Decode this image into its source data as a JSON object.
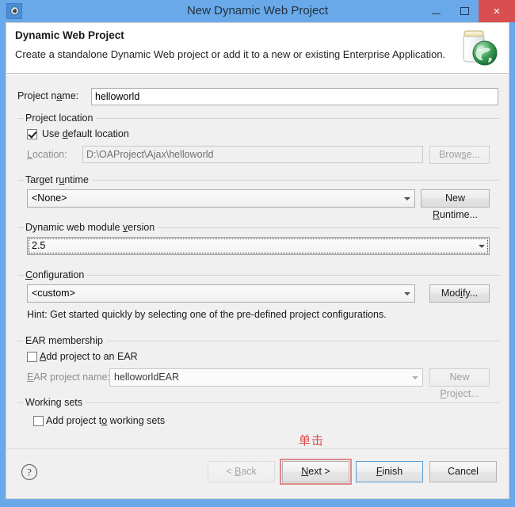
{
  "window": {
    "title": "New Dynamic Web Project",
    "icon": "gear-icon",
    "controls": {
      "minimize": "minimize-icon",
      "maximize": "maximize-icon",
      "close": "×"
    },
    "titlebar_color": "#6aa9e9",
    "close_color": "#d94f4f"
  },
  "header": {
    "title": "Dynamic Web Project",
    "description": "Create a standalone Dynamic Web project or add it to a new or existing Enterprise Application.",
    "icon": "jar-with-globe-icon"
  },
  "form": {
    "project_name": {
      "label": "Project name:",
      "label_pre": "Project n",
      "label_mnemonic": "a",
      "label_post": "me:",
      "value": "helloworld",
      "placeholder": ""
    },
    "project_location": {
      "legend": "Project location",
      "use_default": {
        "label_pre": "Use ",
        "label_mnemonic": "d",
        "label_post": "efault location",
        "checked": true
      },
      "location": {
        "label_mnemonic": "L",
        "label_post": "ocation:",
        "value": "D:\\OAProject\\Ajax\\helloworld",
        "disabled": true
      },
      "browse_button": {
        "label_pre": "Brow",
        "label_mnemonic": "s",
        "label_post": "e...",
        "disabled": true
      }
    },
    "target_runtime": {
      "legend_pre": "Target r",
      "legend_mnemonic": "u",
      "legend_post": "ntime",
      "selected": "<None>",
      "new_button": {
        "label_pre": "New ",
        "label_mnemonic": "R",
        "label_post": "untime..."
      }
    },
    "module_version": {
      "legend_pre": "Dynamic web module ",
      "legend_mnemonic": "v",
      "legend_post": "ersion",
      "selected": "2.5",
      "focused": true
    },
    "configuration": {
      "legend_mnemonic": "C",
      "legend_post": "onfiguration",
      "selected": "<custom>",
      "modify_button": {
        "label_pre": "Mod",
        "label_mnemonic": "i",
        "label_post": "fy..."
      },
      "hint": "Hint: Get started quickly by selecting one of the pre-defined project configurations."
    },
    "ear_membership": {
      "legend": "EAR membership",
      "add_to_ear": {
        "label_mnemonic": "A",
        "label_post": "dd project to an EAR",
        "checked": false
      },
      "ear_project_name": {
        "label_mnemonic": "E",
        "label_post": "AR project name:",
        "value": "helloworldEAR",
        "disabled": true
      },
      "new_project_button": {
        "label_pre": "New ",
        "label_mnemonic": "P",
        "label_post": "roject...",
        "disabled": true
      }
    },
    "working_sets": {
      "legend": "Working sets",
      "add_to_working_sets": {
        "label_pre": "Add project t",
        "label_mnemonic": "o",
        "label_post": " working sets",
        "checked": false
      }
    }
  },
  "footer": {
    "help_icon": "question-mark-icon",
    "buttons": {
      "back": {
        "label_pre": "< ",
        "label_mnemonic": "B",
        "label_post": "ack",
        "disabled": true
      },
      "next": {
        "label_pre": "",
        "label_mnemonic": "N",
        "label_post": "ext >",
        "highlighted": true
      },
      "finish": {
        "label_pre": "",
        "label_mnemonic": "F",
        "label_post": "inish",
        "default": true
      },
      "cancel": {
        "label": "Cancel"
      }
    }
  },
  "annotation": {
    "text": "单击",
    "color": "#e04b4b"
  }
}
